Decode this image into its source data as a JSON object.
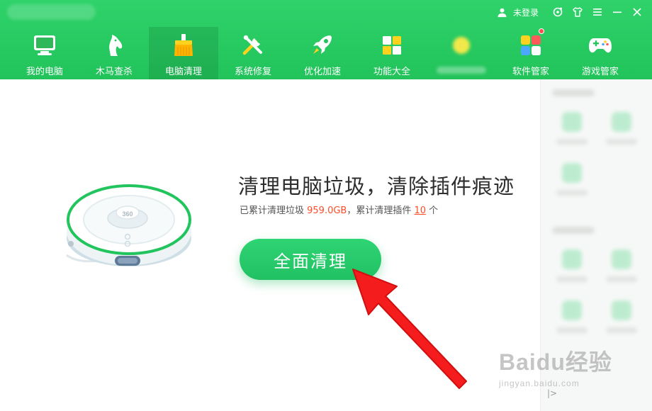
{
  "titlebar": {
    "login_label": "未登录",
    "icons": [
      "user-icon",
      "settings-icon",
      "skin-icon",
      "menu-icon",
      "minimize-icon",
      "close-icon"
    ]
  },
  "nav": {
    "items": [
      {
        "label": "我的电脑",
        "icon": "monitor-icon"
      },
      {
        "label": "木马查杀",
        "icon": "horse-icon"
      },
      {
        "label": "电脑清理",
        "icon": "broom-icon",
        "active": true
      },
      {
        "label": "系统修复",
        "icon": "tools-icon"
      },
      {
        "label": "优化加速",
        "icon": "rocket-icon"
      },
      {
        "label": "功能大全",
        "icon": "grid-icon"
      },
      {
        "label": "",
        "icon": "blurred-icon"
      },
      {
        "label": "软件管家",
        "icon": "apps-icon"
      },
      {
        "label": "游戏管家",
        "icon": "gamepad-icon"
      }
    ]
  },
  "main": {
    "headline": "清理电脑垃圾，清除插件痕迹",
    "sub_prefix": "已累计清理垃圾 ",
    "sub_size": "959.0GB",
    "sub_mid": "，累计清理插件 ",
    "sub_count": "10",
    "sub_suffix": " 个",
    "clean_button": "全面清理",
    "robot_badge": "360"
  },
  "sidebar": {
    "toggle": "|>"
  },
  "watermark": {
    "main": "Baidu经验",
    "sub": "jingyan.baidu.com"
  },
  "colors": {
    "header_green": "#21c35a",
    "button_green": "#21c163",
    "accent_red": "#ff4d2a",
    "arrow_red": "#f41c1c"
  }
}
